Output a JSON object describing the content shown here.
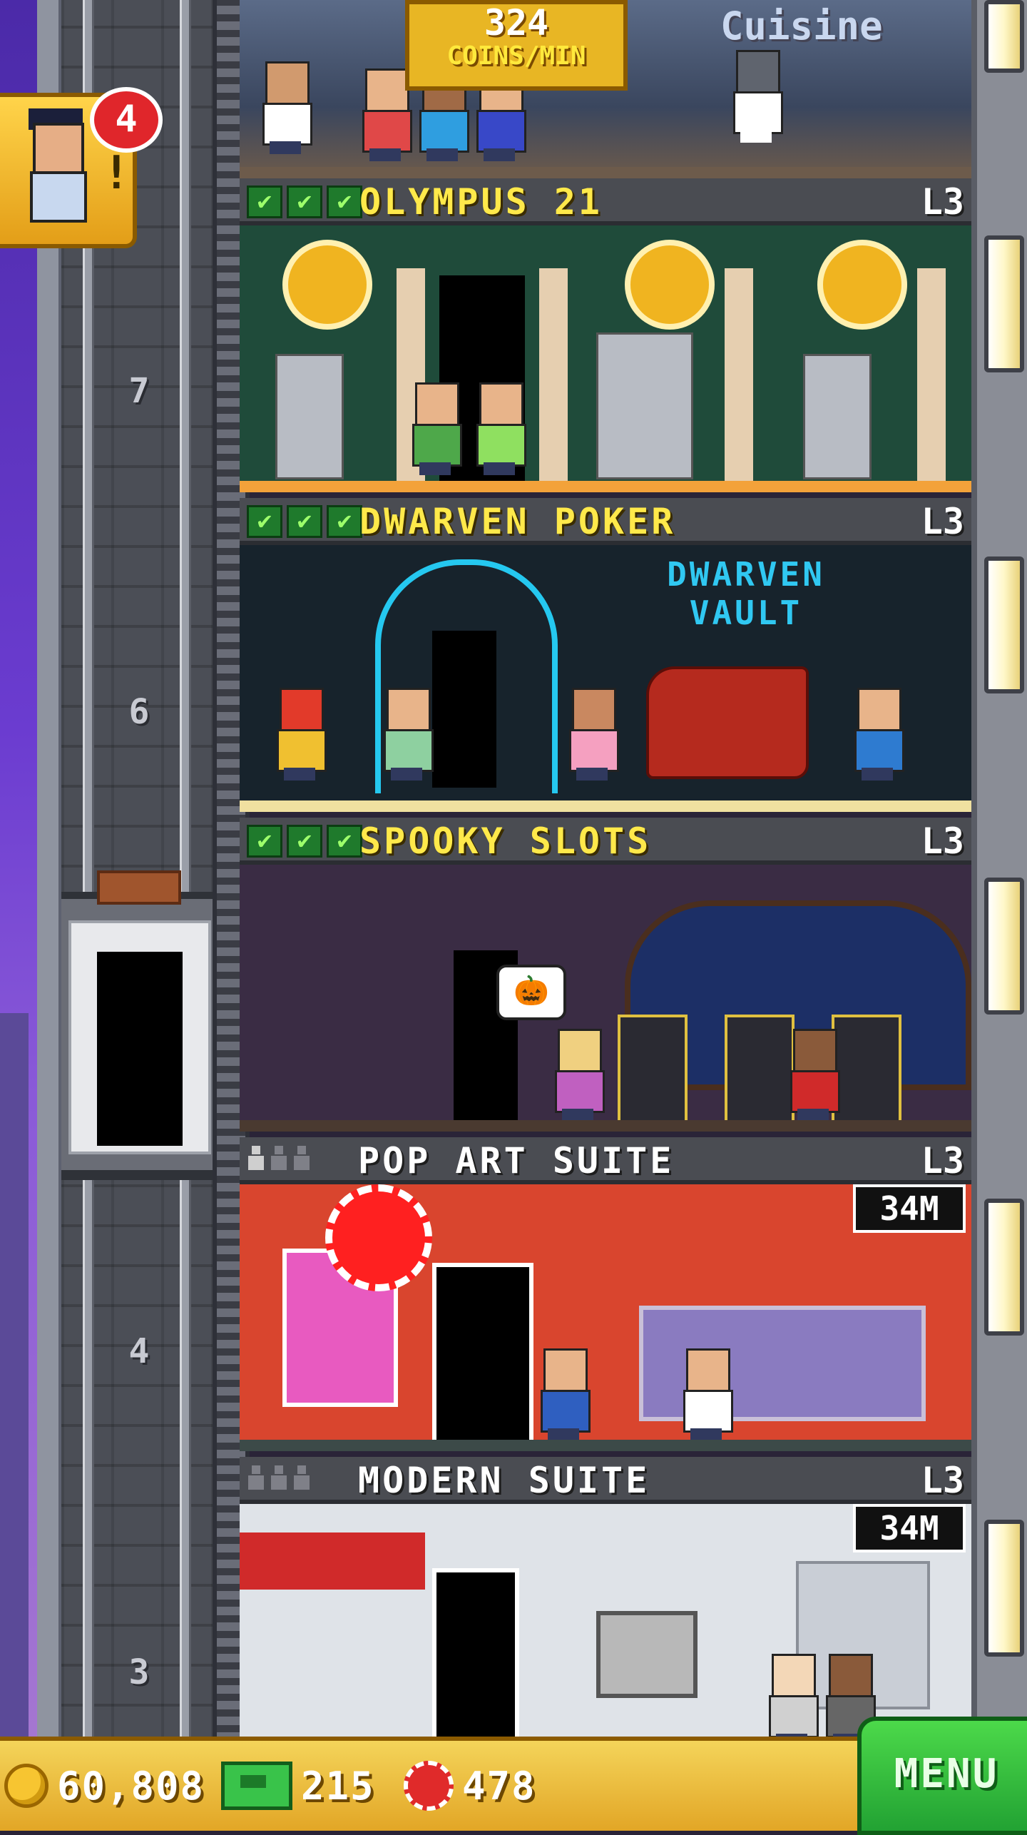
{
  "top_banner": {
    "amount": "324",
    "unit": "COINS/MIN",
    "sign": "Cuisine"
  },
  "vip_notification": {
    "count": "4",
    "icon": "vip-visitor-icon"
  },
  "floors": [
    {
      "name": "OLYMPUS 21",
      "level": "L3",
      "type": "commercial",
      "stocked_checks": 3
    },
    {
      "name": "DWARVEN POKER",
      "level": "L3",
      "type": "commercial",
      "stocked_checks": 3,
      "sign": "DWARVEN VAULT"
    },
    {
      "name": "SPOOKY SLOTS",
      "level": "L3",
      "type": "commercial",
      "stocked_checks": 3
    },
    {
      "name": "POP ART SUITE",
      "level": "L3",
      "type": "residential",
      "price": "34M",
      "residents": 1,
      "capacity": 3
    },
    {
      "name": "MODERN SUITE",
      "level": "L3",
      "type": "residential",
      "price": "34M",
      "residents": 0,
      "capacity": 3
    }
  ],
  "elevator_floor_numbers": [
    "7",
    "6",
    "4",
    "3"
  ],
  "status_bar": {
    "coins": "60,808",
    "tower_bux": "215",
    "chips": "478"
  },
  "menu_button": "MENU",
  "colors": {
    "floor_name": "#ffe94a",
    "check": "#1f7a2c",
    "menu": "#22a233",
    "status_bar": "#e2a626"
  }
}
